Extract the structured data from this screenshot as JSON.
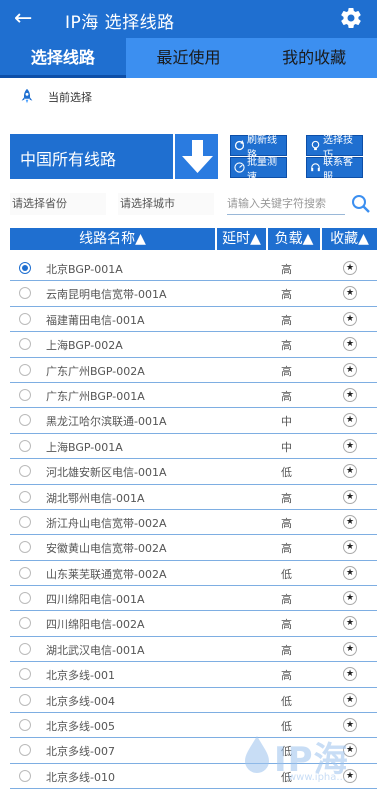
{
  "header": {
    "title": "IP海 选择线路",
    "back_icon": "back-arrow-icon",
    "settings_icon": "gear-icon",
    "bg_color": "#1f6fd0"
  },
  "tabs": [
    {
      "label": "选择线路",
      "active": true
    },
    {
      "label": "最近使用",
      "active": false
    },
    {
      "label": "我的收藏",
      "active": false
    }
  ],
  "current_selection": {
    "label": "当前选择",
    "icon": "rocket-icon"
  },
  "region_button": {
    "label": "中国所有线路",
    "icon": "down-arrow-icon"
  },
  "actions": {
    "refresh": "刷新线路",
    "tips": "选择技巧",
    "speedtest": "批量测速",
    "support": "联系客服"
  },
  "filters": {
    "province": "请选择省份",
    "city": "请选择城市",
    "search_placeholder": "请输入关键字符搜索"
  },
  "table": {
    "columns": [
      "线路名称▲",
      "延时▲",
      "负载▲",
      "收藏▲"
    ],
    "rows": [
      {
        "name": "北京BGP-001A",
        "load": "高",
        "selected": true
      },
      {
        "name": "云南昆明电信宽带-001A",
        "load": "高",
        "selected": false
      },
      {
        "name": "福建莆田电信-001A",
        "load": "高",
        "selected": false
      },
      {
        "name": "上海BGP-002A",
        "load": "高",
        "selected": false
      },
      {
        "name": "广东广州BGP-002A",
        "load": "高",
        "selected": false
      },
      {
        "name": "广东广州BGP-001A",
        "load": "高",
        "selected": false
      },
      {
        "name": "黑龙江哈尔滨联通-001A",
        "load": "中",
        "selected": false
      },
      {
        "name": "上海BGP-001A",
        "load": "中",
        "selected": false
      },
      {
        "name": "河北雄安新区电信-001A",
        "load": "低",
        "selected": false
      },
      {
        "name": "湖北鄂州电信-001A",
        "load": "高",
        "selected": false
      },
      {
        "name": "浙江舟山电信宽带-002A",
        "load": "高",
        "selected": false
      },
      {
        "name": "安徽黄山电信宽带-002A",
        "load": "高",
        "selected": false
      },
      {
        "name": "山东莱芜联通宽带-002A",
        "load": "低",
        "selected": false
      },
      {
        "name": "四川绵阳电信-001A",
        "load": "高",
        "selected": false
      },
      {
        "name": "四川绵阳电信-002A",
        "load": "高",
        "selected": false
      },
      {
        "name": "湖北武汉电信-001A",
        "load": "高",
        "selected": false
      },
      {
        "name": "北京多线-001",
        "load": "高",
        "selected": false
      },
      {
        "name": "北京多线-004",
        "load": "低",
        "selected": false
      },
      {
        "name": "北京多线-005",
        "load": "低",
        "selected": false
      },
      {
        "name": "北京多线-007",
        "load": "低",
        "selected": false
      },
      {
        "name": "北京多线-010",
        "load": "低",
        "selected": false
      }
    ]
  },
  "watermark": {
    "text": "IP海",
    "url": "www.ipha..."
  }
}
